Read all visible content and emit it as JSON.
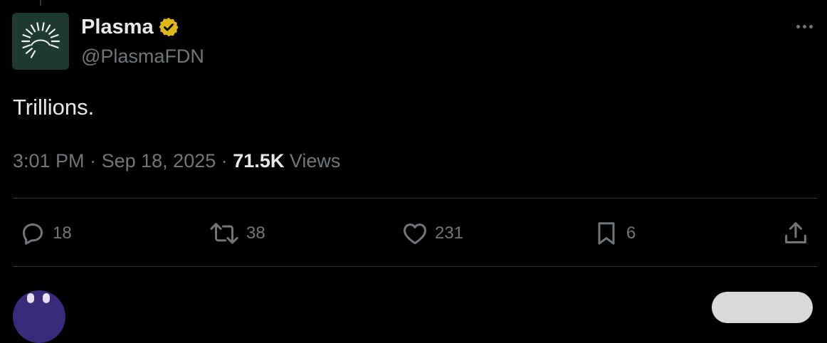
{
  "author": {
    "display_name": "Plasma",
    "handle": "@PlasmaFDN",
    "verified_badge_color": "#e2b719",
    "avatar_background": "#1f3a2e"
  },
  "tweet": {
    "text": "Trillions.",
    "time": "3:01 PM",
    "separator": "·",
    "date": "Sep 18, 2025",
    "views_count": "71.5K",
    "views_label": "Views"
  },
  "actions": {
    "reply": {
      "icon": "reply-icon",
      "count": "18"
    },
    "repost": {
      "icon": "repost-icon",
      "count": "38"
    },
    "like": {
      "icon": "heart-icon",
      "count": "231"
    },
    "bookmark": {
      "icon": "bookmark-icon",
      "count": "6"
    },
    "share": {
      "icon": "share-icon"
    }
  },
  "colors": {
    "background": "#000000",
    "primary_text": "#e7e9ea",
    "secondary_text": "#71767b",
    "divider": "#2f3336"
  }
}
